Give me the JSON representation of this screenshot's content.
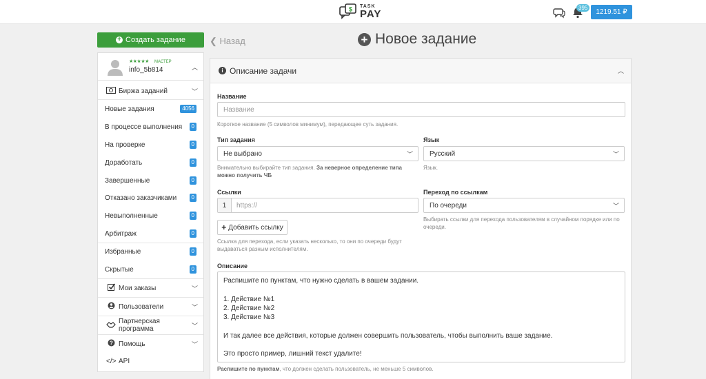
{
  "header": {
    "logo_top": "TASK",
    "logo_bottom": "PAY",
    "notifications_count": "395",
    "balance": "1219.51 ₽"
  },
  "sidebar": {
    "create_button": "Создать задание",
    "profile": {
      "rank": "МАСТЕР",
      "stars": "★★★★★",
      "username": "info_5b814"
    },
    "exchange_label": "Биржа заданий",
    "task_items": [
      {
        "label": "Новые задания",
        "count": "4056"
      },
      {
        "label": "В процессе выполнения",
        "count": "0"
      },
      {
        "label": "На проверке",
        "count": "0"
      },
      {
        "label": "Доработать",
        "count": "0"
      },
      {
        "label": "Завершенные",
        "count": "0"
      },
      {
        "label": "Отказано заказчиками",
        "count": "0"
      },
      {
        "label": "Невыполненные",
        "count": "0"
      },
      {
        "label": "Арбитраж",
        "count": "0"
      },
      {
        "label": "Избранные",
        "count": "0"
      },
      {
        "label": "Скрытые",
        "count": "0"
      }
    ],
    "my_orders": "Мои заказы",
    "users": "Пользователи",
    "partner": "Партнерская программа",
    "help": "Помощь",
    "api": "API"
  },
  "main": {
    "back": "Назад",
    "title": "Новое задание",
    "panel_title": "Описание задачи",
    "name_label": "Название",
    "name_placeholder": "Название",
    "name_help": "Короткое название (5 символов минимум), передающее суть задания.",
    "type_label": "Тип задания",
    "type_value": "Не выбрано",
    "type_help_1": "Внимательно выбирайте тип задания. ",
    "type_help_2": "За неверное определение типа можно получить ЧБ",
    "lang_label": "Язык",
    "lang_value": "Русский",
    "lang_help": "Язык.",
    "links_label": "Ссылки",
    "link_index": "1",
    "link_placeholder": "https://",
    "add_link": "Добавить ссылку",
    "links_help": "Ссылка для перехода, если указать несколько, то они по очереди будут выдаваться разным исполнителям.",
    "nav_label": "Переход по ссылкам",
    "nav_value": "По очереди",
    "nav_help": "Выбирать ссылки для перехода пользователям в случайном порядке или по очереди.",
    "desc_label": "Описание",
    "desc_lines": [
      "Распишите по пунктам, что нужно сделать в вашем задании.",
      "",
      "1. Действие №1",
      "2. Действие №2",
      "3. Действие №3",
      "",
      "И так далее все действия, которые должен совершить пользователь, чтобы выполнить ваше задание.",
      "",
      "Это просто пример, лишний текст удалите!"
    ],
    "desc_help_bold": "Распишите по пунктам",
    "desc_help_rest": ", что должен сделать пользователь, не меньше 5 символов."
  }
}
